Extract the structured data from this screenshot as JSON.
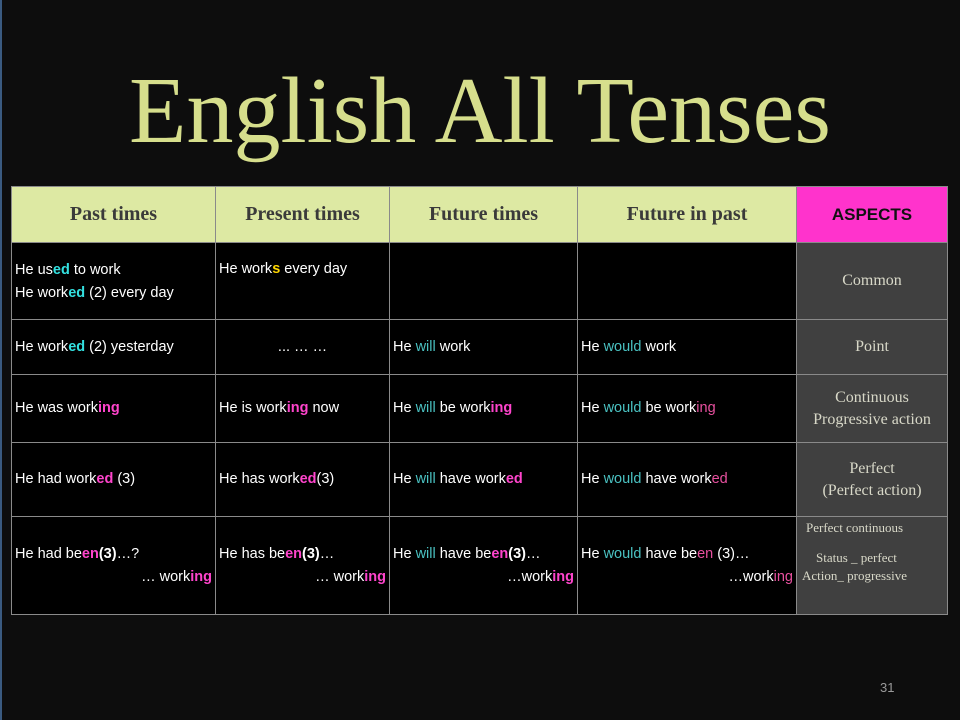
{
  "slide": {
    "title": "English All Tenses",
    "page_number": "31"
  },
  "table": {
    "headers": [
      "Past times",
      "Present times",
      "Future times",
      "Future in past",
      "ASPECTS"
    ],
    "aspects": {
      "common": "Common",
      "point": "Point",
      "continuous_1": "Continuous",
      "continuous_2": "Progressive action",
      "perfect_1": "Perfect",
      "perfect_2": "(Perfect  action)",
      "perfect_continuous_1": "Perfect   continuous",
      "perfect_continuous_2": "Status  _  perfect",
      "perfect_continuous_3": "Action_   progressive"
    },
    "common": {
      "past_1": {
        "a": "He us",
        "b": "ed",
        "c": " to work"
      },
      "past_2": {
        "a": "He work",
        "b": "ed",
        "c": " (2) every day"
      },
      "present": {
        "a": "He work",
        "b": "s",
        "c": " every day"
      }
    },
    "point": {
      "past": {
        "a": "He work",
        "b": "ed",
        "c": " (2)  yesterday"
      },
      "present": "... … …",
      "future": {
        "a": "He ",
        "b": "will",
        "c": "  work"
      },
      "future_past": {
        "a": "He ",
        "b": "would",
        "c": " work"
      }
    },
    "continuous": {
      "past": {
        "a": "He was work",
        "b": "ing"
      },
      "present": {
        "a": "He is work",
        "b": "ing",
        "c": "  now"
      },
      "future": {
        "a": "He ",
        "b": "will",
        "c": " be  work",
        "d": "ing"
      },
      "future_past": {
        "a": "He ",
        "b": "would",
        "c": "  be  work",
        "d": "ing"
      }
    },
    "perfect": {
      "past": {
        "a": "He had work",
        "b": "ed",
        "c": " (3)"
      },
      "present": {
        "a": "He has work",
        "b": "ed",
        "c": "(3)"
      },
      "future": {
        "a": "He ",
        "b": "will",
        "c": " have  work",
        "d": "ed"
      },
      "future_past": {
        "a": "He ",
        "b": "would",
        "c": "  have work",
        "d": "ed"
      }
    },
    "perfect_continuous": {
      "past": {
        "a": "He had  be",
        "b": "en",
        "c": "(3)",
        "d": "…?",
        "e": "… work",
        "f": "ing"
      },
      "present": {
        "a": "He has  be",
        "b": "en",
        "c": "(3)",
        "d": "…",
        "e": "… work",
        "f": "ing"
      },
      "future": {
        "a": "He ",
        "b": "will",
        "c": " have be",
        "d": "en",
        "e": "(3)",
        "f": "…",
        "g": "…work",
        "h": "ing"
      },
      "future_past": {
        "a": "He ",
        "b": "would",
        "c": "  have be",
        "d": "en",
        "e": " (3)…",
        "f": "…work",
        "g": "ing"
      }
    }
  }
}
